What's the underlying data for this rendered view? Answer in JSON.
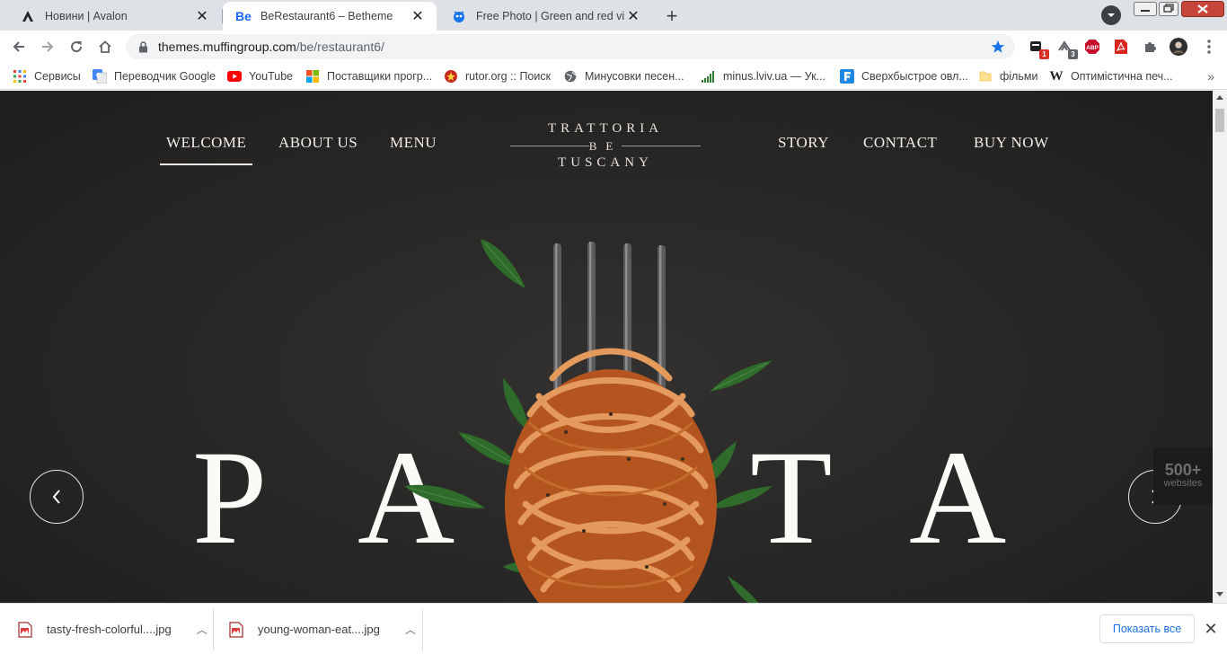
{
  "browser": {
    "tabs": [
      {
        "title": "Новини | Avalon",
        "icon": "avalon-logo-icon"
      },
      {
        "title": "BeRestaurant6 – Betheme",
        "icon": "behance-be-icon",
        "icon_text": "Be"
      },
      {
        "title": "Free Photo | Green and red viney",
        "icon": "freepik-icon"
      }
    ],
    "address": {
      "host": "themes.muffingroup.com",
      "path": "/be/restaurant6/"
    },
    "extensions": [
      {
        "icon": "notification-extension-icon",
        "badge": "1"
      },
      {
        "icon": "tab-counter-extension-icon",
        "badge": "3"
      },
      {
        "icon": "adblock-plus-icon",
        "label": "ABP"
      },
      {
        "icon": "acrobat-icon"
      },
      {
        "icon": "puzzle-extensions-icon"
      },
      {
        "icon": "profile-avatar-icon"
      }
    ],
    "bookmarks": [
      {
        "label": "Сервисы",
        "icon": "apps-grid-icon"
      },
      {
        "label": "Переводчик Google",
        "icon": "google-translate-icon"
      },
      {
        "label": "YouTube",
        "icon": "youtube-icon"
      },
      {
        "label": "Поставщики прогр...",
        "icon": "microsoft-icon"
      },
      {
        "label": "rutor.org :: Поиск",
        "icon": "rutor-icon"
      },
      {
        "label": "Минусовки песен...",
        "icon": "globe-icon"
      },
      {
        "label": "minus.lviv.ua — Ук...",
        "icon": "signal-bars-icon"
      },
      {
        "label": "Сверхбыстрое овл...",
        "icon": "f-logo-icon"
      },
      {
        "label": "фільми",
        "icon": "folder-icon"
      },
      {
        "label": "Оптимістична печ...",
        "icon": "wikipedia-icon",
        "icon_text": "W"
      }
    ]
  },
  "site": {
    "nav_left": [
      "WELCOME",
      "ABOUT US",
      "MENU"
    ],
    "nav_right": [
      "STORY",
      "CONTACT",
      "BUY NOW"
    ],
    "logo": {
      "line1": "TRATTORIA",
      "line2": "BE",
      "line3": "TUSCANY"
    },
    "hero_word_letters": [
      "P",
      "A",
      "T",
      "A"
    ],
    "promo": {
      "number": "500+",
      "label": "websites"
    }
  },
  "downloads": {
    "files": [
      "tasty-fresh-colorful....jpg",
      "young-woman-eat....jpg"
    ],
    "show_all": "Показать все"
  },
  "colors": {
    "hero_bg": "#272626",
    "accent_link": "#1a73e8",
    "bookmark_star": "#1a73e8"
  }
}
